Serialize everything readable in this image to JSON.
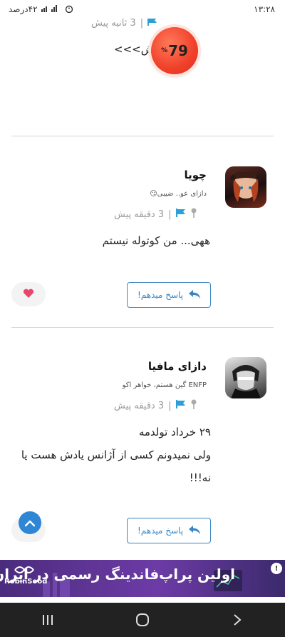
{
  "status_bar": {
    "time": "۱۳:۲۸",
    "battery": "۴۲درصد"
  },
  "top_post": {
    "time_ago": "3 ثانیه پیش",
    "text_fragment": "انش>>>",
    "score_value": "79",
    "score_unit": "%"
  },
  "comments": [
    {
      "username": "چویا",
      "subtitle": "دازای عو.. ضیبی😏",
      "time_ago": "3 دقیقه پیش",
      "lines": [
        "ههی... من کوتوله نیستم"
      ],
      "reply_label": "پاسخ میدهم!"
    },
    {
      "username": "دازای مافیا",
      "subtitle": "ENFP گین هستم، خواهر اکو",
      "time_ago": "3 دقیقه پیش",
      "lines": [
        "۲۹ خرداد تولدمه",
        "ولی نمیدونم کسی از آژانس یادش هست یا",
        "نه!!!"
      ],
      "reply_label": "پاسخ میدهم!"
    }
  ],
  "ad": {
    "headline": "اولین پراپ‌فاندینگ رسمی در ایران",
    "brand": "RobinSood",
    "info": "!"
  },
  "colors": {
    "accent": "#3a86c4",
    "score": "#f0402a",
    "heart": "#e8456b"
  }
}
